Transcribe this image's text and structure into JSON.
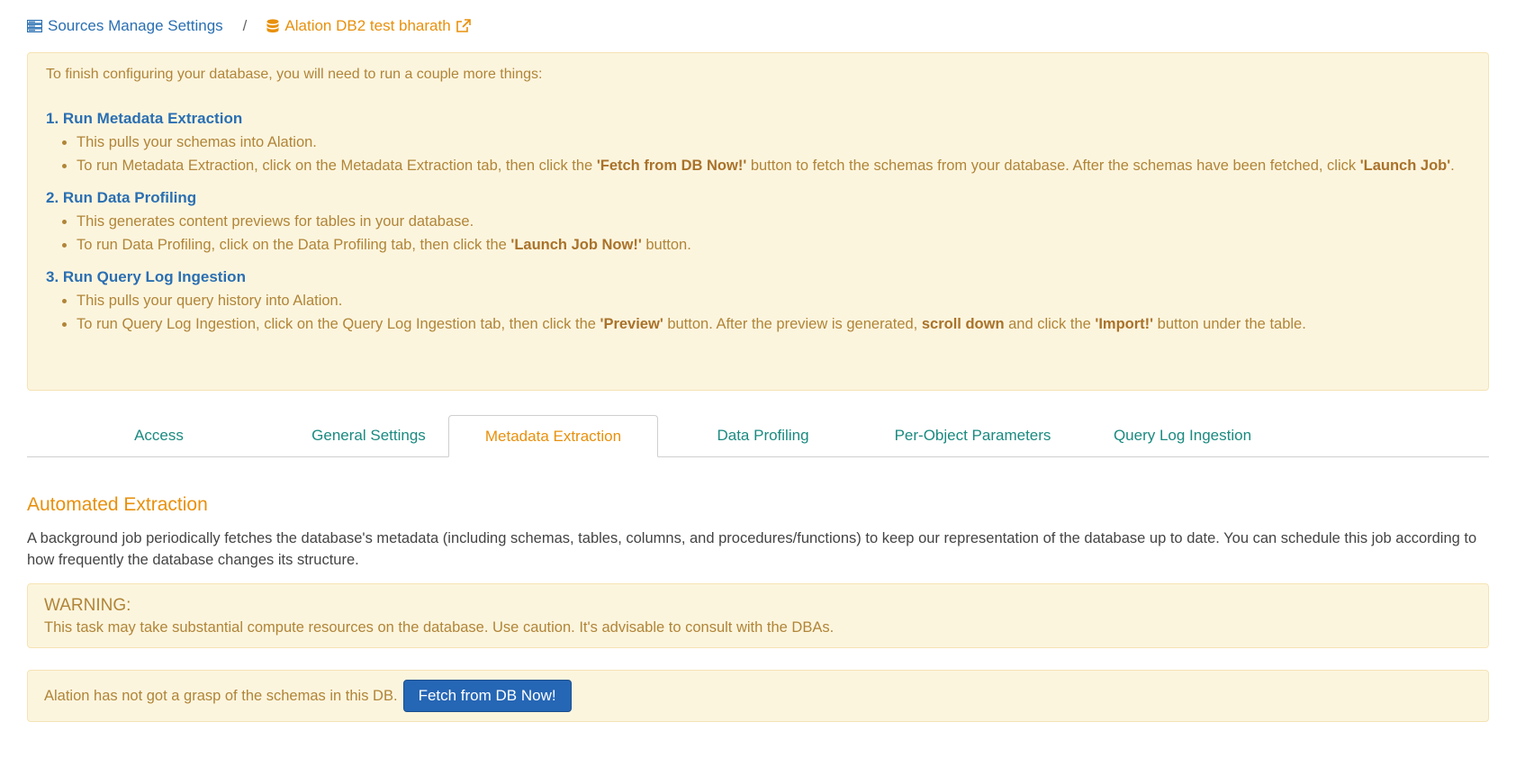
{
  "breadcrumb": {
    "parent_label": "Sources Manage Settings",
    "separator": "/",
    "current_label": "Alation DB2 test bharath"
  },
  "setup_notice": {
    "intro": "To finish configuring your database, you will need to run a couple more things:",
    "steps": [
      {
        "title": "1. Run Metadata Extraction",
        "bullet1": "This pulls your schemas into Alation.",
        "bullet2_a": "To run Metadata Extraction, click on the Metadata Extraction tab, then click the ",
        "bullet2_b": "'Fetch from DB Now!'",
        "bullet2_c": " button to fetch the schemas from your database. After the schemas have been fetched, click ",
        "bullet2_d": "'Launch Job'",
        "bullet2_e": "."
      },
      {
        "title": "2. Run Data Profiling",
        "bullet1": "This generates content previews for tables in your database.",
        "bullet2_a": "To run Data Profiling, click on the Data Profiling tab, then click the ",
        "bullet2_b": "'Launch Job Now!'",
        "bullet2_c": " button."
      },
      {
        "title": "3. Run Query Log Ingestion",
        "bullet1": "This pulls your query history into Alation.",
        "bullet2_a": "To run Query Log Ingestion, click on the Query Log Ingestion tab, then click the ",
        "bullet2_b": "'Preview'",
        "bullet2_c": " button. After the preview is generated, ",
        "bullet2_d": "scroll down",
        "bullet2_e": " and click the ",
        "bullet2_f": "'Import!'",
        "bullet2_g": " button under the table."
      }
    ]
  },
  "tabs": [
    {
      "label": "Access"
    },
    {
      "label": "General Settings"
    },
    {
      "label": "Metadata Extraction"
    },
    {
      "label": "Data Profiling"
    },
    {
      "label": "Per-Object Parameters"
    },
    {
      "label": "Query Log Ingestion"
    }
  ],
  "active_tab": "Metadata Extraction",
  "section": {
    "title": "Automated Extraction",
    "description": "A background job periodically fetches the database's metadata (including schemas, tables, columns, and procedures/functions) to keep our representation of the database up to date. You can schedule this job according to how frequently the database changes its structure."
  },
  "warning": {
    "title": "WARNING:",
    "body": "This task may take substantial compute resources on the database. Use caution. It's advisable to consult with the DBAs."
  },
  "fetch": {
    "text": "Alation has not got a grasp of the schemas in this DB.",
    "button_label": "Fetch from DB Now!"
  },
  "colors": {
    "link_blue": "#2a6fb2",
    "accent_orange": "#e8900c",
    "tab_teal": "#1a8a80",
    "alert_bg": "#fcf5de",
    "alert_text": "#b08538",
    "button_blue": "#2566b5"
  },
  "icons": {
    "parent": "server-list-icon",
    "current": "database-icon",
    "external": "external-link-icon"
  }
}
